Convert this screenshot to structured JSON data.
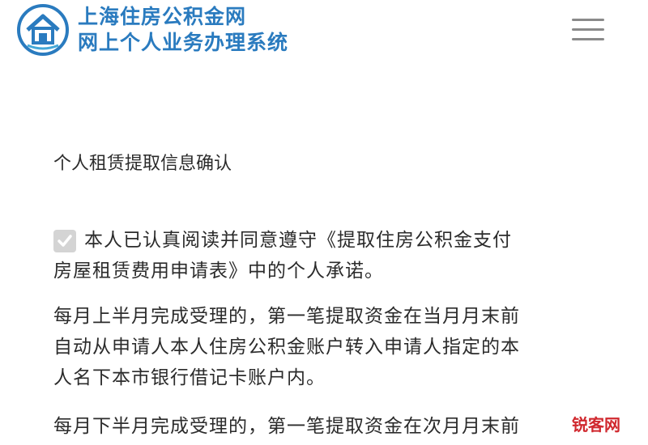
{
  "header": {
    "title": "上海住房公积金网",
    "subtitle": "网上个人业务办理系统",
    "logo_icon": "house-logo-icon",
    "menu_icon": "hamburger-menu-icon"
  },
  "main": {
    "section_title": "个人租赁提取信息确认",
    "agreement": {
      "checked": true,
      "line1": "本人已认真阅读并同意遵守《提取住房公积金支付",
      "line2": "房屋租赁费用申请表》中的个人承诺。"
    },
    "paragraph1": {
      "line1": "每月上半月完成受理的，第一笔提取资金在当月月末前",
      "line2": "自动从申请人本人住房公积金账户转入申请人指定的本",
      "line3": "人名下本市银行借记卡账户内。"
    },
    "paragraph2": {
      "line1": "每月下半月完成受理的，第一笔提取资金在次月月末前"
    }
  },
  "watermark": {
    "text": "锐客网"
  },
  "colors": {
    "brand": "#2a7bbf",
    "text": "#2b2b2b",
    "checkbox": "#d4d4d4",
    "watermark": "#d0282e"
  }
}
